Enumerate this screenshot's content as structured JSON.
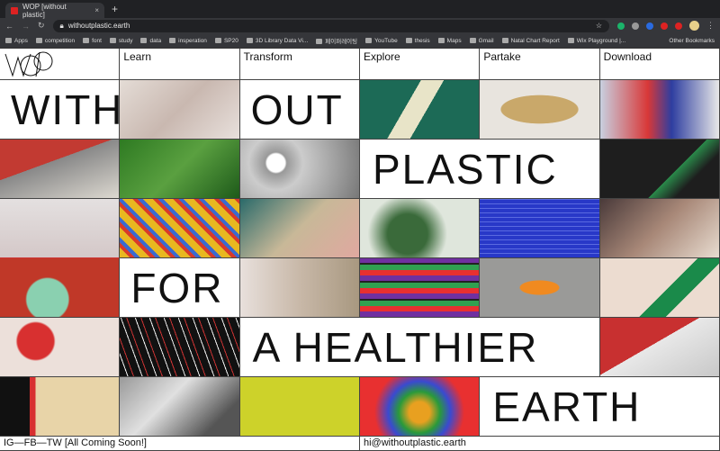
{
  "browser": {
    "tab_title": "WOP [without plastic]",
    "url": "withoutplastic.earth",
    "bookmarks": [
      "Apps",
      "competition",
      "font",
      "study",
      "data",
      "insperation",
      "SP20",
      "3D Library Data Vi...",
      "페이퍼레이팅",
      "YouTube",
      "thesis",
      "Maps",
      "Gmail",
      "Natal Chart Report",
      "Wix Playground |..."
    ],
    "other_bookmarks": "Other Bookmarks"
  },
  "nav": {
    "logo": "WOP",
    "items": [
      "Learn",
      "Transform",
      "Explore",
      "Partake",
      "Download"
    ]
  },
  "headline": {
    "w1": "WITH",
    "w2": "OUT",
    "w3": "PLASTIC",
    "w4": "FOR",
    "w5": "A HEALTHIER",
    "w6": "EARTH"
  },
  "footer": {
    "social": "IG—FB—TW [All Coming Soon!]",
    "email": "hi@withoutplastic.earth"
  }
}
